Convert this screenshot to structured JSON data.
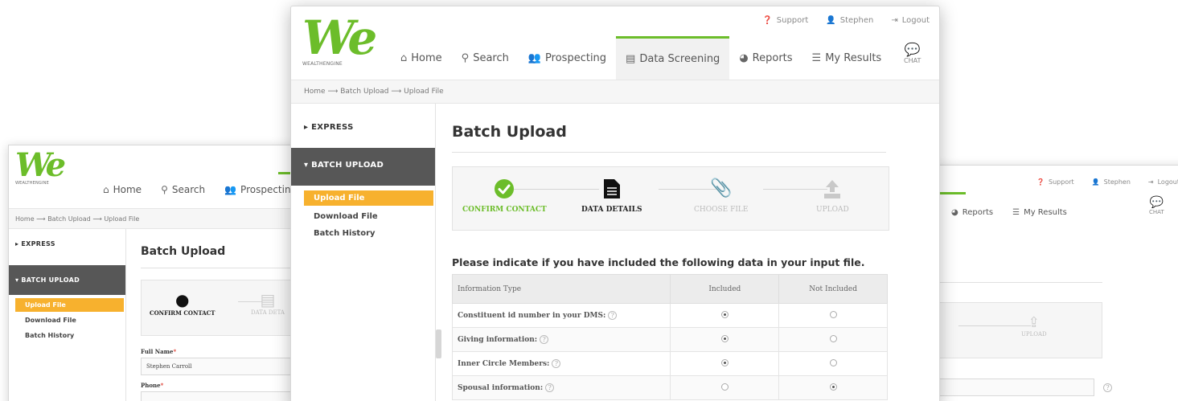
{
  "brand": {
    "logo_text": "We",
    "logo_sub": "WEALTHENGINE"
  },
  "utility": {
    "support": "Support",
    "user": "Stephen",
    "logout": "Logout"
  },
  "nav": {
    "home": "Home",
    "search": "Search",
    "prospecting": "Prospecting",
    "data_screening": "Data Screening",
    "reports": "Reports",
    "my_results": "My Results",
    "chat": "CHAT"
  },
  "breadcrumb": {
    "home": "Home",
    "sep": "⟶",
    "batch_upload": "Batch Upload",
    "upload_file": "Upload File"
  },
  "sidebar": {
    "express": "EXPRESS",
    "batch_upload": "BATCH UPLOAD",
    "upload_file": "Upload File",
    "download_file": "Download File",
    "batch_history": "Batch History"
  },
  "page": {
    "title": "Batch Upload"
  },
  "steps": {
    "confirm_contact": "CONFIRM CONTACT",
    "data_details": "DATA DETAILS",
    "choose_file": "CHOOSE FILE",
    "upload": "UPLOAD",
    "data_details_truncated": "DATA DETA"
  },
  "question": "Please indicate if you have included the following data in your input file.",
  "table": {
    "headers": [
      "Information Type",
      "Included",
      "Not Included"
    ],
    "rows": [
      {
        "label": "Constituent id number in your DMS:",
        "included": true
      },
      {
        "label": "Giving information:",
        "included": true
      },
      {
        "label": "Inner Circle Members:",
        "included": true
      },
      {
        "label": "Spousal information:",
        "included": false
      }
    ]
  },
  "form": {
    "full_name_label": "Full Name",
    "full_name_value": "Stephen Carroll",
    "phone_label": "Phone",
    "required_mark": "*"
  },
  "help_glyph": "?",
  "colors": {
    "brand_green": "#6cbd2a",
    "accent_orange": "#f7b12e",
    "sidebar_dark": "#575757"
  },
  "icons": {
    "home": "home-icon",
    "search": "search-icon",
    "prospecting": "users-icon",
    "data_screening": "document-icon",
    "reports": "pie-chart-icon",
    "my_results": "list-icon",
    "chat": "chat-icon",
    "support": "question-circle-icon",
    "user": "user-icon",
    "logout": "sign-out-icon"
  }
}
